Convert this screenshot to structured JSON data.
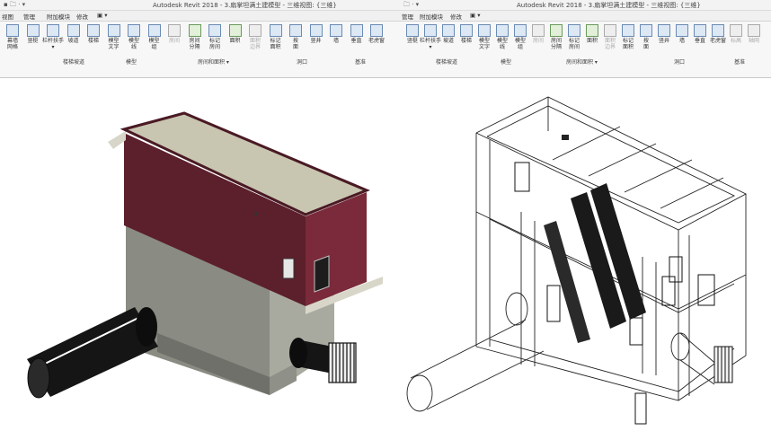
{
  "left": {
    "qat": "▪ 🗀 · ▾",
    "title": "Autodesk Revit 2018 -   3.扇掌坦满土建模型 - 三维视图: {三维}",
    "tabs": [
      "视图",
      "管理",
      "附加模块",
      "修改",
      "▣ ▾"
    ],
    "tools": [
      {
        "label": "幕墙\n网格",
        "style": ""
      },
      {
        "label": "竖梃",
        "style": ""
      },
      {
        "label": "栏杆扶手\n▾",
        "style": ""
      },
      {
        "label": "坡道",
        "style": ""
      },
      {
        "label": "楼梯",
        "style": ""
      },
      {
        "label": "模型\n文字",
        "style": ""
      },
      {
        "label": "模型\n线",
        "style": ""
      },
      {
        "label": "模型\n组",
        "style": ""
      },
      {
        "label": "房间",
        "style": "gray"
      },
      {
        "label": "房间\n分隔",
        "style": "grn"
      },
      {
        "label": "标记\n房间",
        "style": ""
      },
      {
        "label": "面积",
        "style": "grn"
      },
      {
        "label": "面积\n边界",
        "style": "gray"
      },
      {
        "label": "标记\n面积",
        "style": ""
      },
      {
        "label": "按\n面",
        "style": ""
      },
      {
        "label": "竖井",
        "style": ""
      },
      {
        "label": "墙",
        "style": ""
      },
      {
        "label": "垂直",
        "style": ""
      },
      {
        "label": "老虎窗",
        "style": ""
      }
    ],
    "panels": [
      "楼梯坡道",
      "模型",
      "房间和面积 ▾",
      "洞口",
      "基准"
    ]
  },
  "right": {
    "qat": "🗀 · ▾",
    "title": "Autodesk Revit 2018 -   3.扇掌坦满土建模型 - 三维视图: {三维}",
    "tabs": [
      "管理",
      "附加模块",
      "修改",
      "▣ ▾"
    ],
    "tools": [
      {
        "label": "竖梃",
        "style": ""
      },
      {
        "label": "栏杆扶手\n▾",
        "style": ""
      },
      {
        "label": "坡道",
        "style": ""
      },
      {
        "label": "楼梯",
        "style": ""
      },
      {
        "label": "模型\n文字",
        "style": ""
      },
      {
        "label": "模型\n线",
        "style": ""
      },
      {
        "label": "模型\n组",
        "style": ""
      },
      {
        "label": "房间",
        "style": "gray"
      },
      {
        "label": "房间\n分隔",
        "style": "grn"
      },
      {
        "label": "标记\n房间",
        "style": ""
      },
      {
        "label": "面积",
        "style": "grn"
      },
      {
        "label": "面积\n边界",
        "style": "gray"
      },
      {
        "label": "标记\n面积",
        "style": ""
      },
      {
        "label": "按\n面",
        "style": ""
      },
      {
        "label": "竖井",
        "style": ""
      },
      {
        "label": "墙",
        "style": ""
      },
      {
        "label": "垂直",
        "style": ""
      },
      {
        "label": "老虎窗",
        "style": ""
      },
      {
        "label": "标高",
        "style": "gray"
      },
      {
        "label": "轴网",
        "style": "gray"
      }
    ],
    "panels": [
      "楼梯坡道",
      "模型",
      "房间和面积 ▾",
      "洞口",
      "基准"
    ]
  },
  "colors": {
    "roof": "#c8c5b0",
    "upper_wall": "#5c1f2c",
    "upper_wall_side": "#7a2a3a",
    "lower_wall": "#8a8b82",
    "lower_wall_side": "#a9aa9f",
    "pipe": "#151515",
    "wire": "#222222"
  }
}
